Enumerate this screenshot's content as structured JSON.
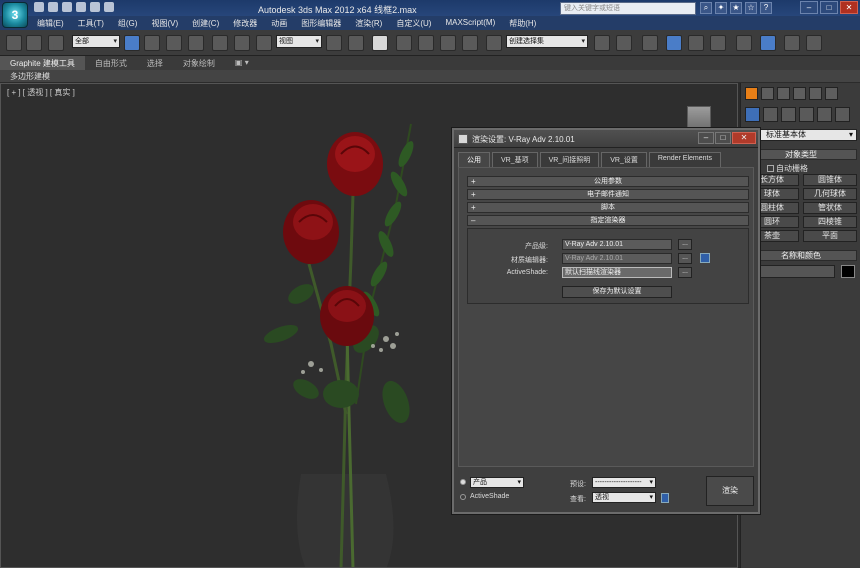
{
  "app": {
    "title": "Autodesk 3ds Max  2012 x64    线框2.max",
    "search_placeholder": "键入关键字或短语",
    "logo_glyph": "3"
  },
  "menu": [
    "编辑(E)",
    "工具(T)",
    "组(G)",
    "视图(V)",
    "创建(C)",
    "修改器",
    "动画",
    "图形编辑器",
    "渲染(R)",
    "自定义(U)",
    "MAXScript(M)",
    "帮助(H)"
  ],
  "toolbar": {
    "selection_filter": "全部",
    "reference_coord": "视图",
    "named_selection": "创建选择集"
  },
  "ribbon": {
    "tabs": [
      "Graphite 建模工具",
      "自由形式",
      "选择",
      "对象绘制",
      "▣ ▾"
    ],
    "sub_label": "多边形建模"
  },
  "viewport": {
    "label": "[ + ] [ 透视 ] [ 真实 ]"
  },
  "command_panel": {
    "category": "标准基本体",
    "object_type_title": "对象类型",
    "autogrid": "自动栅格",
    "buttons": [
      "长方体",
      "圆锥体",
      "球体",
      "几何球体",
      "圆柱体",
      "管状体",
      "圆环",
      "四棱锥",
      "茶壶",
      "平面"
    ],
    "name_color_title": "名称和颜色"
  },
  "render_dialog": {
    "title": "渲染设置: V-Ray Adv 2.10.01",
    "tabs": [
      "公用",
      "VR_基项",
      "VR_间接照明",
      "VR_设置",
      "Render Elements"
    ],
    "rollouts": [
      "公用参数",
      "电子邮件通知",
      "脚本",
      "指定渲染器"
    ],
    "assign": {
      "production_label": "产品级:",
      "production_value": "V-Ray Adv 2.10.01",
      "material_label": "材质编辑器:",
      "material_value": "V-Ray Adv 2.10.01",
      "activeshade_label": "ActiveShade:",
      "activeshade_value": "默认扫描线渲染器",
      "save_default": "保存为默认设置",
      "dots": "..."
    },
    "footer": {
      "mode_product": "产品",
      "mode_activeshade": "ActiveShade",
      "preset_label": "预设:",
      "preset_value": "--------------------",
      "view_label": "查看:",
      "view_value": "透视",
      "render_button": "渲染"
    }
  }
}
